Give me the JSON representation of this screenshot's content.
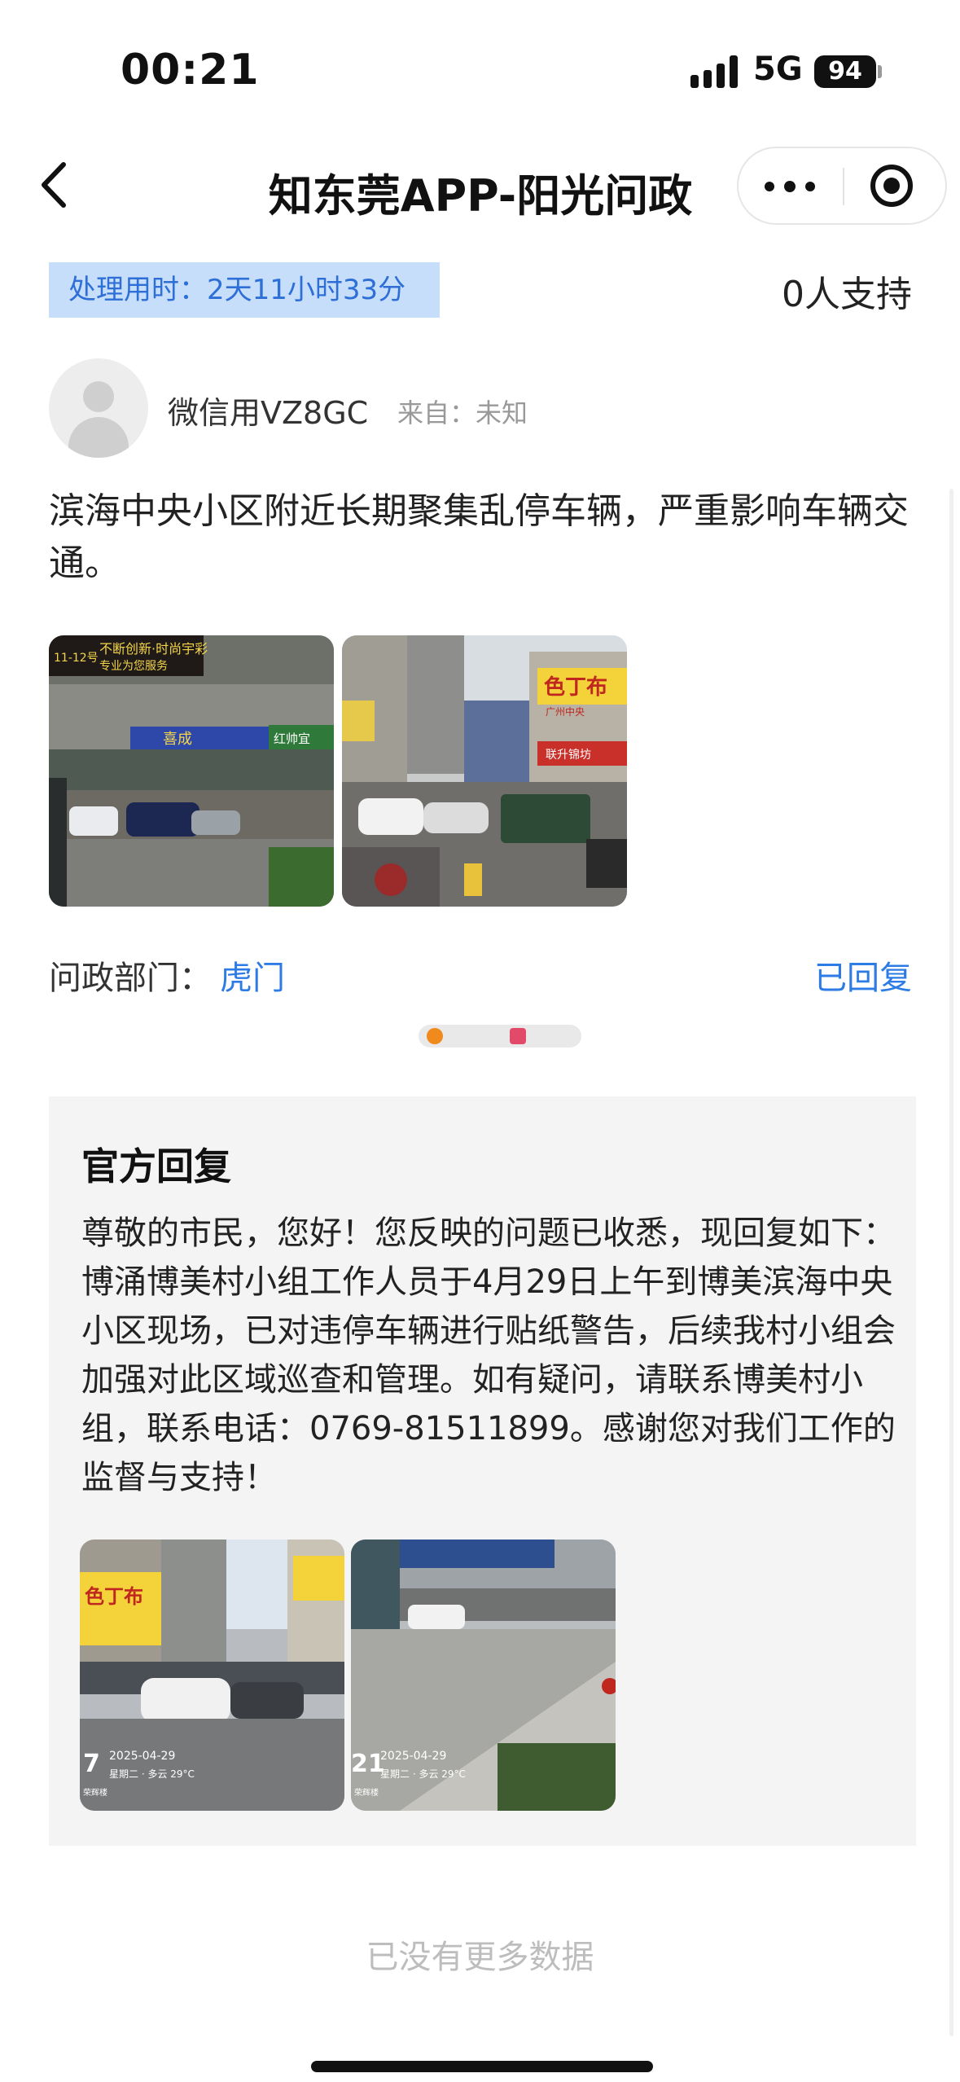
{
  "status_bar": {
    "time": "00:21",
    "network": "5G",
    "battery": "94"
  },
  "nav": {
    "title": "知东莞APP-阳光问政"
  },
  "post": {
    "process_time": "处理用时：2天11小时33分",
    "support": "0人支持",
    "user": {
      "name": "微信用VZ8GC",
      "from": "来自：未知"
    },
    "content": "滨海中央小区附近长期聚集乱停车辆，严重影响车辆交通。",
    "photos": [
      {
        "signs": [
          "不断创新·时尚宇彩",
          "专业为您服务",
          "喜成",
          "红帅宜"
        ],
        "sign_number": "11-12号"
      },
      {
        "signs": [
          "色丁布",
          "广州中央",
          "联升锦坊"
        ]
      }
    ],
    "department_label": "问政部门：",
    "department": "虎门",
    "status": "已回复"
  },
  "reply": {
    "title": "官方回复",
    "text": "尊敬的市民，您好！您反映的问题已收悉，现回复如下：博涌博美村小组工作人员于4月29日上午到博美滨海中央小区现场，已对违停车辆进行贴纸警告，后续我村小组会加强对此区域巡查和管理。如有疑问，请联系博美村小组，联系电话：0769-81511899。感谢您对我们工作的监督与支持！",
    "photos": [
      {
        "time_big": "7",
        "date": "2025-04-29",
        "weather": "星期二 · 多云 29°C",
        "place": "荣辉楼",
        "sign": "色丁布"
      },
      {
        "time_big": "21",
        "date": "2025-04-29",
        "weather": "星期二 · 多云 29°C",
        "place": "荣辉楼"
      }
    ]
  },
  "footer": {
    "empty": "已没有更多数据"
  }
}
